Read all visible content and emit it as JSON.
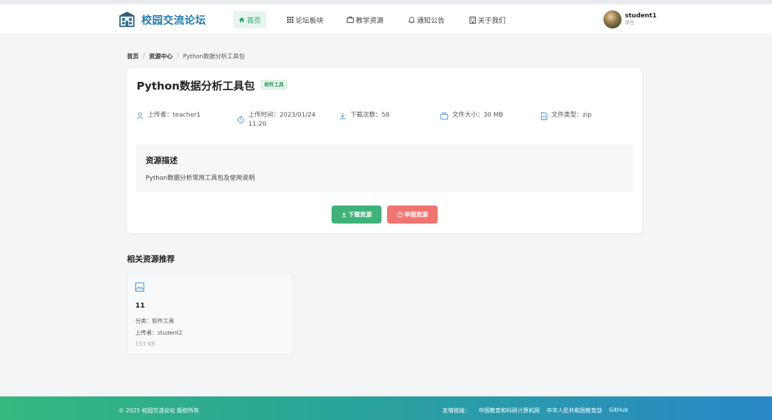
{
  "app": {
    "name": "校园交流论坛"
  },
  "nav": {
    "items": [
      {
        "label": "首页",
        "icon": "home-icon",
        "active": true
      },
      {
        "label": "论坛板块",
        "icon": "grid-icon"
      },
      {
        "label": "教学资源",
        "icon": "folder-icon"
      },
      {
        "label": "通知公告",
        "icon": "bell-icon"
      },
      {
        "label": "关于我们",
        "icon": "building-icon"
      }
    ]
  },
  "user": {
    "name": "student1",
    "role": "学生"
  },
  "breadcrumb": [
    "首页",
    "/",
    "资源中心",
    "/",
    "Python数据分析工具包"
  ],
  "resource": {
    "title": "Python数据分析工具包",
    "category_tag": "软件工具",
    "uploader": "上传者：teacher1",
    "upload_time_line1": "上传时间：2023/01/24",
    "upload_time_line2": "11:20",
    "downloads": "下载次数：58",
    "file_size": "文件大小：30 MB",
    "file_type": "文件类型：zip",
    "description_title": "资源描述",
    "description": "Python数据分析常用工具包及使用说明",
    "download_button": "下载资源",
    "report_button": "举报资源"
  },
  "related": {
    "title": "相关资源推荐",
    "items": [
      {
        "name": "11",
        "category": "分类：软件工具",
        "uploader": "上传者：student2",
        "size": "153 KB",
        "icon": "image-icon"
      }
    ]
  },
  "footer": {
    "copyright": "© 2025 校园交流论坛 版权所有",
    "links_label": "友情链接：",
    "links": [
      "中国教育和科研计算机网",
      "中华人民共和国教育部",
      "GitHub"
    ]
  },
  "colors": {
    "brand": "#1f7ab0",
    "accent_green": "#3fb27b",
    "danger_red": "#f07470"
  }
}
